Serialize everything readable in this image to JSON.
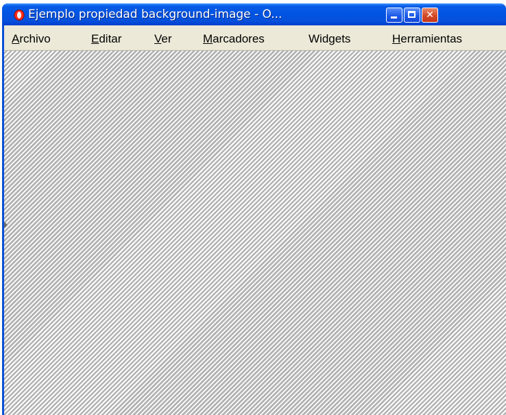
{
  "window": {
    "title": "Ejemplo propiedad background-image - O...",
    "icon": "opera-logo-icon",
    "controls": {
      "minimize": "minimize-icon",
      "maximize": "maximize-icon",
      "close": "close-icon",
      "close_symbol": "✕"
    }
  },
  "menubar": {
    "items": [
      {
        "pre": "",
        "accel": "A",
        "post": "rchivo"
      },
      {
        "pre": "",
        "accel": "E",
        "post": "ditar"
      },
      {
        "pre": "",
        "accel": "V",
        "post": "er"
      },
      {
        "pre": "",
        "accel": "M",
        "post": "arcadores"
      },
      {
        "pre": "Wid",
        "accel": "g",
        "post": "ets"
      },
      {
        "pre": "",
        "accel": "H",
        "post": "erramientas"
      }
    ]
  },
  "colors": {
    "titlebar": "#0054e3",
    "menubar": "#ece9d8",
    "stripe_light": "#ffffff",
    "stripe_dark": "#b2b2b2",
    "close_button": "#d24a28"
  }
}
